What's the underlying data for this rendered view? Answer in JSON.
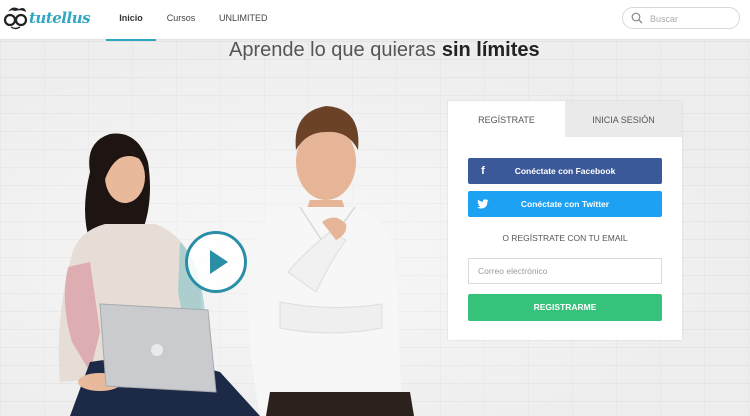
{
  "brand": {
    "name": "tutellus",
    "color": "#2fa7c1"
  },
  "nav": {
    "items": [
      {
        "label": "Inicio",
        "active": true
      },
      {
        "label": "Cursos",
        "active": false
      },
      {
        "label": "UNLIMITED",
        "active": false
      }
    ]
  },
  "search": {
    "placeholder": "Buscar",
    "icon": "search-icon"
  },
  "hero": {
    "headline_light": "Aprende lo que quieras",
    "headline_bold": "sin límites",
    "play_icon": "play-icon"
  },
  "register": {
    "tabs": [
      {
        "label": "REGÍSTRATE",
        "active": true
      },
      {
        "label": "INICIA SESIÓN",
        "active": false
      }
    ],
    "facebook": {
      "label": "Conéctate con Facebook",
      "icon": "facebook-icon",
      "color": "#3b5998"
    },
    "twitter": {
      "label": "Conéctate con Twitter",
      "icon": "twitter-icon",
      "color": "#1da1f2"
    },
    "divider": "O REGÍSTRATE CON TU EMAIL",
    "email_placeholder": "Correo electrónico",
    "submit": {
      "label": "REGISTRARME",
      "color": "#37c27b"
    }
  }
}
